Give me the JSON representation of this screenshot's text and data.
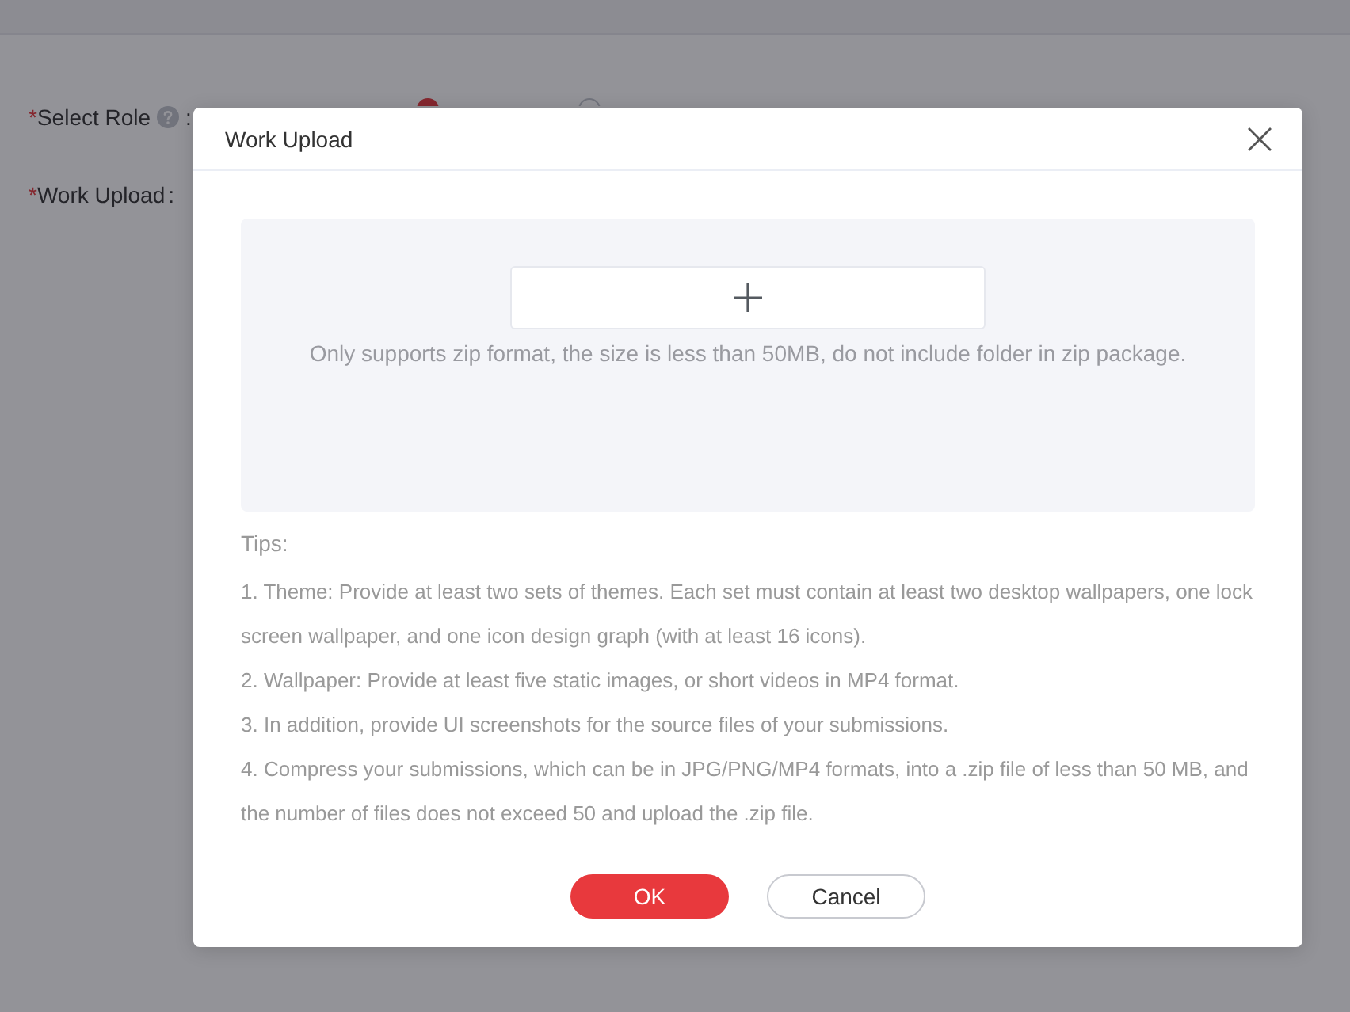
{
  "form": {
    "fields": [
      {
        "required_mark": "*",
        "label": "Select Role",
        "help": true,
        "colon": ":",
        "options": [
          {
            "selected": true
          },
          {
            "selected": false
          }
        ]
      },
      {
        "required_mark": "*",
        "label": "Work Upload",
        "help": false,
        "colon": ":"
      }
    ]
  },
  "dialog": {
    "title": "Work Upload",
    "upload": {
      "hint": "Only supports zip format, the size is less than 50MB, do not include folder in zip package."
    },
    "tips_title": "Tips:",
    "tips": [
      "1. Theme: Provide at least two sets of themes. Each set must contain at least two desktop wallpapers, one lock screen wallpaper, and one icon design graph (with at least 16 icons).",
      "2. Wallpaper: Provide at least five static images, or short videos in MP4 format.",
      "3. In addition, provide UI screenshots for the source files of your submissions.",
      "4. Compress your submissions, which can be in JPG/PNG/MP4 formats, into a .zip file of less than 50 MB, and the number of files does not exceed 50 and upload the .zip file."
    ],
    "buttons": [
      {
        "label": "OK",
        "kind": "primary"
      },
      {
        "label": "Cancel",
        "kind": "default"
      }
    ]
  }
}
